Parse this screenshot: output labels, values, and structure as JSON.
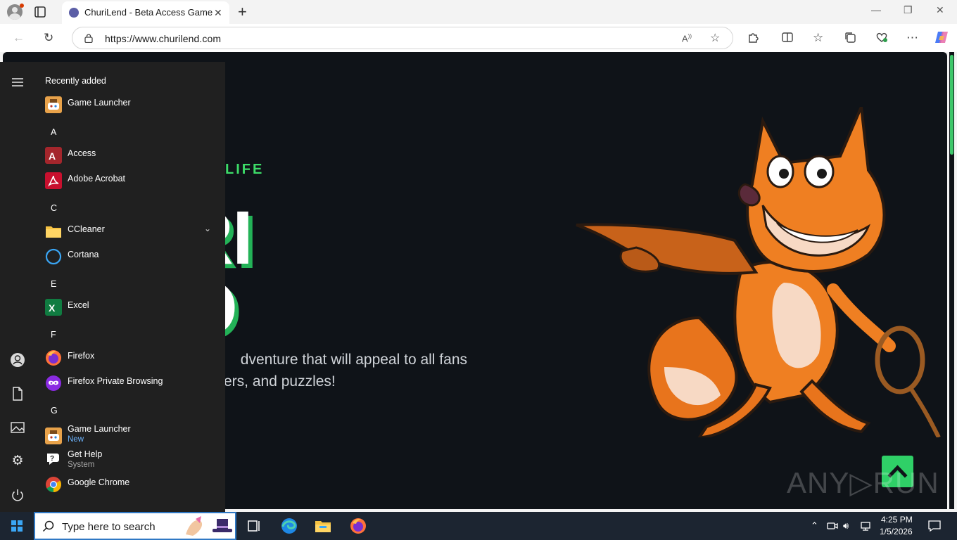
{
  "browser": {
    "tab_title": "ChuriLend - Beta Access Game",
    "tab_close": "✕",
    "new_tab": "+",
    "url": "https://www.churilend.com",
    "window_controls": {
      "minimize": "—",
      "restore": "❐",
      "close": "✕"
    }
  },
  "page": {
    "eyebrow": "LIFE",
    "hero_line1": "RI",
    "hero_line2": "O",
    "description": "dventure that will appeal to all fans ers, and puzzles!",
    "description_line1": "dventure that will appeal to all fans",
    "description_line2": "ers, and puzzles!",
    "accent_color": "#3ddc68",
    "background_color": "#0f1318",
    "watermark": "ANY▷RUN"
  },
  "start_menu": {
    "section_title": "Recently added",
    "recent": [
      {
        "label": "Game Launcher",
        "icon": "game-launcher-icon"
      }
    ],
    "groups": [
      {
        "letter": "A",
        "apps": [
          {
            "label": "Access",
            "icon": "access-icon"
          },
          {
            "label": "Adobe Acrobat",
            "icon": "acrobat-icon"
          }
        ]
      },
      {
        "letter": "C",
        "apps": [
          {
            "label": "CCleaner",
            "icon": "folder-icon",
            "expandable": true
          },
          {
            "label": "Cortana",
            "icon": "cortana-icon"
          }
        ]
      },
      {
        "letter": "E",
        "apps": [
          {
            "label": "Excel",
            "icon": "excel-icon"
          }
        ]
      },
      {
        "letter": "F",
        "apps": [
          {
            "label": "Firefox",
            "icon": "firefox-icon"
          },
          {
            "label": "Firefox Private Browsing",
            "icon": "firefox-private-icon"
          }
        ]
      },
      {
        "letter": "G",
        "apps": [
          {
            "label": "Game Launcher",
            "sublabel": "New",
            "icon": "game-launcher-icon"
          },
          {
            "label": "Get Help",
            "sublabel": "System",
            "icon": "get-help-icon"
          },
          {
            "label": "Google Chrome",
            "icon": "chrome-icon"
          }
        ]
      }
    ]
  },
  "taskbar": {
    "search_placeholder": "Type here to search",
    "time": "4:25 PM",
    "date": "1/5/2026"
  }
}
